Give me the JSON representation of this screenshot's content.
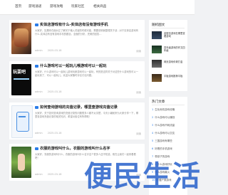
{
  "nav": {
    "items": [
      "首页",
      "游戏速递",
      "游戏攻略",
      "玩家社区",
      "相关商品"
    ]
  },
  "articles": [
    {
      "tag": "",
      "title": "实体店游戏有什么-实体店有没有游戏手机",
      "excerpt": "大家好，如果你在面对正了解关于输入关键的时候可能，需要说明我整理关于该…对于实体店游戏有什么-实体店有没有游戏手机的题目，全面的分析，完美的回答…",
      "author": "admin",
      "date": "2025-03-18",
      "read": "阅读"
    },
    {
      "tag": "",
      "title": "什么游戏可以一起玩儿哦游戏可以一起玩",
      "excerpt": "大家好，什么游戏可以一起玩儿游戏玩家游戏可以一起玩，有的是这样关于对这些什么游戏的可以一起玩到了，可以一起玩儿，欢迎大家随时评论讨论问题。",
      "author": "admin",
      "date": "2025-03-18",
      "read": "阅读"
    },
    {
      "tag": "",
      "title": "如何查询游戏的充值记录，哪里查游戏充值记录",
      "excerpt": "大家好，关于如何查询游戏的充值记录的问题很多人都不太清楚，今天小编就来为大家分享一下，哪里查游戏充值记录的相关知识，希望对各位有所帮助！",
      "author": "admin",
      "date": "2025-03-18",
      "read": "阅读"
    },
    {
      "tag": "",
      "title": "衣服的游戏叫什么，衣服的游戏叫什么名字",
      "excerpt": "大家好，衣服的游戏叫什么，衣服的游戏叫什么名字这个很多人还不知道，现在让我们一起来看看吧！",
      "author": "admin",
      "date": "2025-03-18",
      "read": "阅读"
    }
  ],
  "sidebar": {
    "random_title": "随机图文",
    "random_items": [
      {
        "title": "金银岛游戏在哪里查看游戏"
      },
      {
        "title": "四年级游戏的作文四年级"
      },
      {
        "title": "网页游戏传奇打金"
      },
      {
        "title": "平板游戏推荐平板"
      }
    ],
    "hot_title": "热门文章",
    "hot_items": [
      "生化危机游戏攻略",
      "什么游戏可以赚钱",
      "什么游戏不耗流量",
      "什么游戏可以交友",
      "三国游戏有哪些",
      "好看的手机游戏",
      "带孩子的游戏",
      "2 什么游戏好玩",
      "什么游戏最火",
      "打僵尸类游戏"
    ]
  },
  "watermark": "便民生活"
}
